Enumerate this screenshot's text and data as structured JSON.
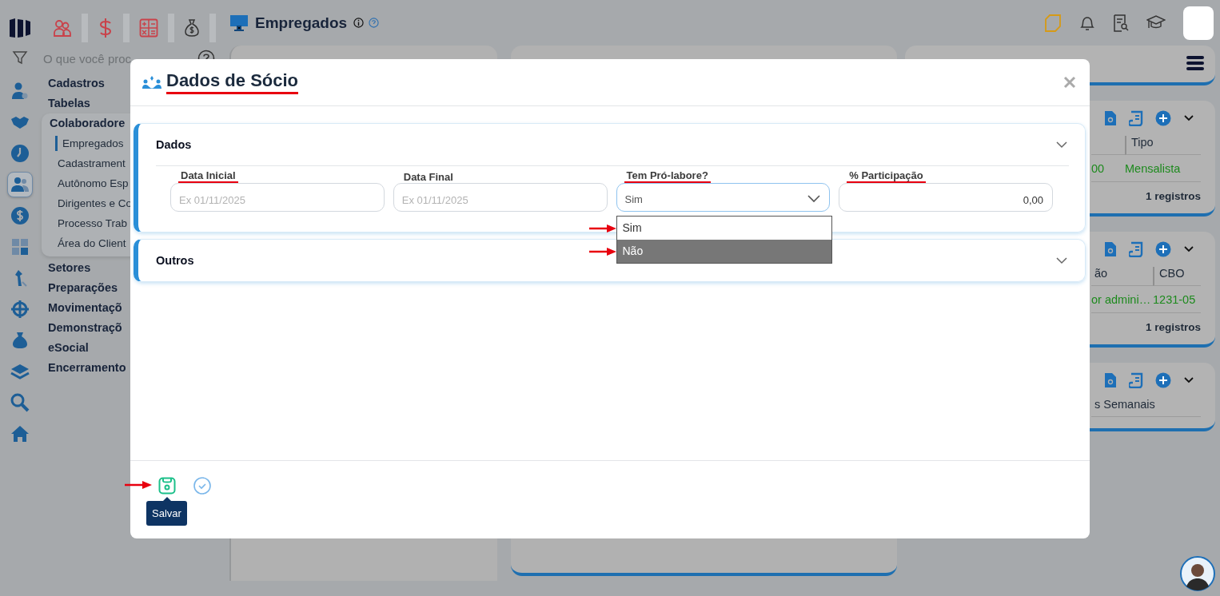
{
  "rail": [
    {
      "kind": "user-gear",
      "selected": false
    },
    {
      "kind": "handshake",
      "selected": false
    },
    {
      "kind": "clock",
      "selected": false
    },
    {
      "kind": "people",
      "selected": true
    },
    {
      "kind": "dollar",
      "selected": false
    },
    {
      "kind": "calculator",
      "selected": false
    },
    {
      "kind": "pen",
      "selected": false
    },
    {
      "kind": "gear",
      "selected": false
    },
    {
      "kind": "money-bag",
      "selected": false
    },
    {
      "kind": "layers",
      "selected": false
    },
    {
      "kind": "search",
      "selected": false
    },
    {
      "kind": "home",
      "selected": false
    }
  ],
  "page_title": "Empregados",
  "search": {
    "placeholder": "O que você proc"
  },
  "menu": [
    {
      "label": "Cadastros",
      "expanded": false
    },
    {
      "label": "Tabelas",
      "expanded": false
    },
    {
      "label": "Colaboradore",
      "expanded": true,
      "children": [
        {
          "label": "Empregados",
          "selected": true
        },
        {
          "label": "Cadastrament",
          "selected": false
        },
        {
          "label": "Autônomo Esp",
          "selected": false
        },
        {
          "label": "Dirigentes e Co",
          "selected": false
        },
        {
          "label": "Processo Trab",
          "selected": false
        },
        {
          "label": "Área do Client",
          "selected": false
        }
      ]
    },
    {
      "label": "Setores",
      "expanded": false
    },
    {
      "label": "Preparações",
      "expanded": false
    },
    {
      "label": "Movimentaçõ",
      "expanded": false
    },
    {
      "label": "Demonstraçõ",
      "expanded": false
    },
    {
      "label": "eSocial",
      "expanded": false
    },
    {
      "label": "Encerramento",
      "expanded": false
    }
  ],
  "right_panels": [
    {
      "kind": "menu"
    },
    {
      "kind": "table",
      "columns": [
        "",
        "Tipo"
      ],
      "rows": [
        [
          "00",
          "Mensalista"
        ]
      ],
      "footer": "1 registros"
    },
    {
      "kind": "table",
      "columns": [
        "ão",
        "CBO"
      ],
      "rows": [
        [
          "or admini…",
          "1231-05"
        ]
      ],
      "footer": "1 registros"
    },
    {
      "kind": "table",
      "columns": [
        "s Semanais"
      ]
    }
  ],
  "dialog": {
    "title": "Dados de Sócio",
    "title_marked": true,
    "sections": [
      {
        "title": "Dados",
        "expanded": true,
        "fields": [
          {
            "kind": "date",
            "label": "Data Inicial",
            "placeholder": "Ex 01/11/2025",
            "marked": true
          },
          {
            "kind": "date",
            "label": "Data Final",
            "placeholder": "Ex 01/11/2025",
            "marked": false
          },
          {
            "kind": "select",
            "label": "Tem Pró-labore?",
            "value": "Sim",
            "marked": true,
            "open": true,
            "options": [
              {
                "label": "Sim",
                "highlighted": false,
                "arrow": true
              },
              {
                "label": "Não",
                "highlighted": true,
                "arrow": true
              }
            ]
          },
          {
            "kind": "number",
            "label": "% Participação",
            "value": "0,00",
            "marked": true
          }
        ]
      },
      {
        "title": "Outros",
        "expanded": false
      }
    ],
    "footer_buttons": [
      {
        "kind": "save",
        "tooltip": "Salvar",
        "arrow": true
      },
      {
        "kind": "confirm"
      }
    ]
  }
}
